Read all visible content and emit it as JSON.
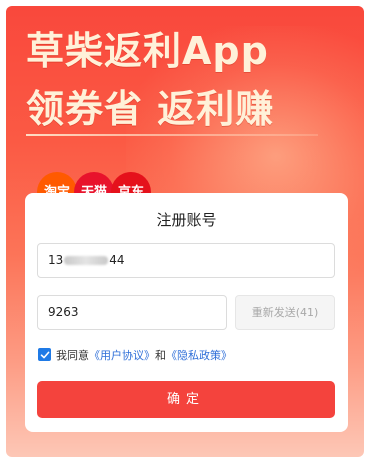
{
  "hero": {
    "headline_line1": "草柴返利App",
    "headline_line2": "领券省  返利赚",
    "platforms": [
      "淘宝",
      "天猫",
      "京东"
    ]
  },
  "card": {
    "title": "注册账号",
    "phone_prefix": "13",
    "phone_suffix": "44",
    "code_value": "9263",
    "resend_label": "重新发送(41)",
    "agree_prefix": "我同意",
    "user_agreement": "《用户协议》",
    "and_text": "和",
    "privacy_policy": "《隐私政策》",
    "checkbox_checked": true,
    "confirm_label": "确定"
  },
  "colors": {
    "accent": "#f4433d",
    "link": "#2f6fd8",
    "checkbox": "#1f7ae6"
  }
}
